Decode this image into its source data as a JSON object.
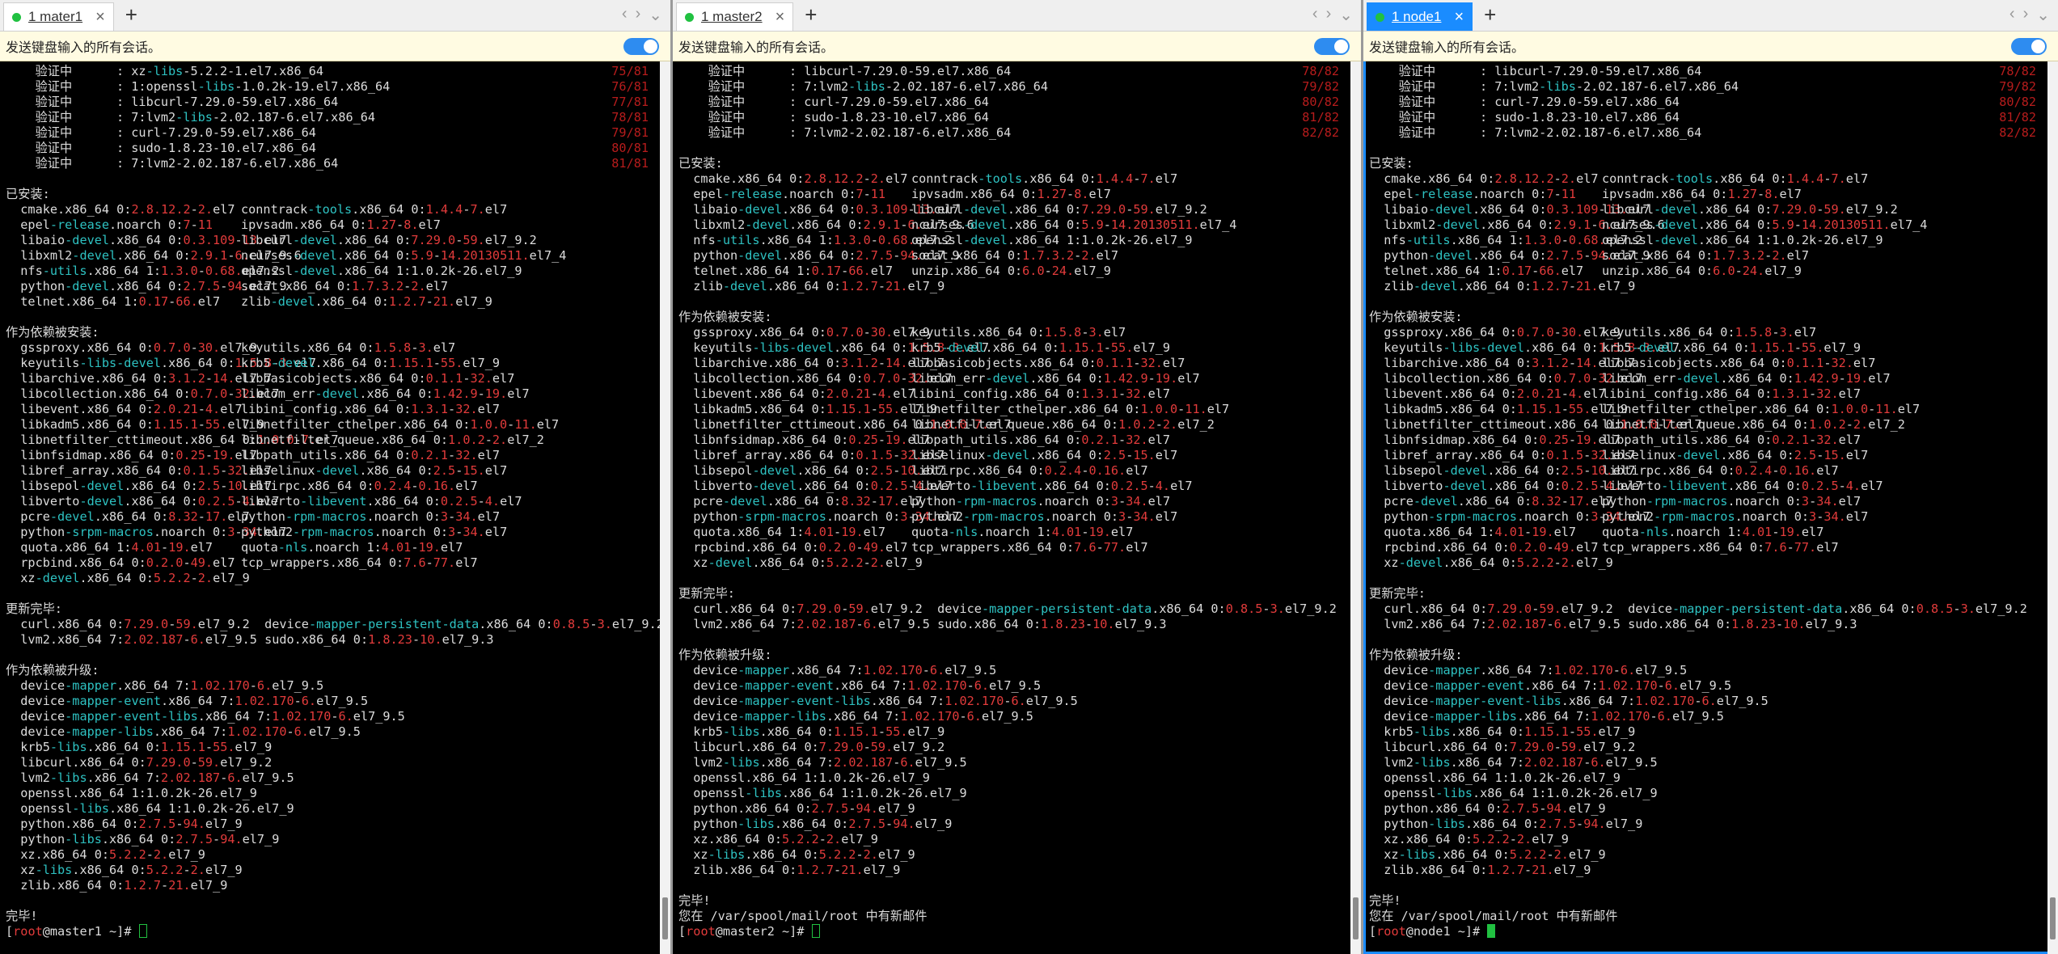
{
  "info_bar": "发送键盘输入的所有会话。",
  "panes": [
    {
      "tab": "1 mater1",
      "prompt_user": "root",
      "prompt_host": "@master1 ~]#",
      "lines": [
        "    验证中      : xz-libs-5.2.2-1.el7.x86_64|75/81",
        "    验证中      : 1:openssl-libs-1.0.2k-19.el7.x86_64|76/81",
        "    验证中      : libcurl-7.29.0-59.el7.x86_64|77/81",
        "    验证中      : 7:lvm2-libs-2.02.187-6.el7.x86_64|78/81",
        "    验证中      : curl-7.29.0-59.el7.x86_64|79/81",
        "    验证中      : sudo-1.8.23-10.el7.x86_64|80/81",
        "    验证中      : 7:lvm2-2.02.187-6.el7.x86_64|81/81",
        "",
        "已安装:",
        "  cmake.x86_64 0:2.8.12.2-2.el7#conntrack-tools.x86_64 0:1.4.4-7.el7",
        "  epel-release.noarch 0:7-11#ipvsadm.x86_64 0:1.27-8.el7",
        "  libaio-devel.x86_64 0:0.3.109-13.el7#libcurl-devel.x86_64 0:7.29.0-59.el7_9.2",
        "  libxml2-devel.x86_64 0:2.9.1-6.el7_9.6#ncurses-devel.x86_64 0:5.9-14.20130511.el7_4",
        "  nfs-utils.x86_64 1:1.3.0-0.68.el7.2#openssl-devel.x86_64 1:1.0.2k-26.el7_9",
        "  python-devel.x86_64 0:2.7.5-94.el7_9#socat.x86_64 0:1.7.3.2-2.el7",
        "  telnet.x86_64 1:0.17-66.el7#zlib-devel.x86_64 0:1.2.7-21.el7_9",
        "",
        "作为依赖被安装:",
        "  gssproxy.x86_64 0:0.7.0-30.el7_9#keyutils.x86_64 0:1.5.8-3.el7",
        "  keyutils-libs-devel.x86_64 0:1.5.8-3.el7#krb5-devel.x86_64 0:1.15.1-55.el7_9",
        "  libarchive.x86_64 0:3.1.2-14.el7_7#libbasicobjects.x86_64 0:0.1.1-32.el7",
        "  libcollection.x86_64 0:0.7.0-32.el7#libcom_err-devel.x86_64 0:1.42.9-19.el7",
        "  libevent.x86_64 0:2.0.21-4.el7#libini_config.x86_64 0:1.3.1-32.el7",
        "  libkadm5.x86_64 0:1.15.1-55.el7_9#libnetfilter_cthelper.x86_64 0:1.0.0-11.el7",
        "  libnetfilter_cttimeout.x86_64 0:1.0.0-7.el7#libnetfilter_queue.x86_64 0:1.0.2-2.el7_2",
        "  libnfsidmap.x86_64 0:0.25-19.el7#libpath_utils.x86_64 0:0.2.1-32.el7",
        "  libref_array.x86_64 0:0.1.5-32.el7#libselinux-devel.x86_64 0:2.5-15.el7",
        "  libsepol-devel.x86_64 0:2.5-10.el7#libtirpc.x86_64 0:0.2.4-0.16.el7",
        "  libverto-devel.x86_64 0:0.2.5-4.el7#libverto-libevent.x86_64 0:0.2.5-4.el7",
        "  pcre-devel.x86_64 0:8.32-17.el7#python-rpm-macros.noarch 0:3-34.el7",
        "  python-srpm-macros.noarch 0:3-34.el7#python2-rpm-macros.noarch 0:3-34.el7",
        "  quota.x86_64 1:4.01-19.el7#quota-nls.noarch 1:4.01-19.el7",
        "  rpcbind.x86_64 0:0.2.0-49.el7#tcp_wrappers.x86_64 0:7.6-77.el7",
        "  xz-devel.x86_64 0:5.2.2-2.el7_9",
        "",
        "更新完毕:",
        "  curl.x86_64 0:7.29.0-59.el7_9.2  device-mapper-persistent-data.x86_64 0:0.8.5-3.el7_9.2",
        "  lvm2.x86_64 7:2.02.187-6.el7_9.5 sudo.x86_64 0:1.8.23-10.el7_9.3",
        "",
        "作为依赖被升级:",
        "  device-mapper.x86_64 7:1.02.170-6.el7_9.5",
        "  device-mapper-event.x86_64 7:1.02.170-6.el7_9.5",
        "  device-mapper-event-libs.x86_64 7:1.02.170-6.el7_9.5",
        "  device-mapper-libs.x86_64 7:1.02.170-6.el7_9.5",
        "  krb5-libs.x86_64 0:1.15.1-55.el7_9",
        "  libcurl.x86_64 0:7.29.0-59.el7_9.2",
        "  lvm2-libs.x86_64 7:2.02.187-6.el7_9.5",
        "  openssl.x86_64 1:1.0.2k-26.el7_9",
        "  openssl-libs.x86_64 1:1.0.2k-26.el7_9",
        "  python.x86_64 0:2.7.5-94.el7_9",
        "  python-libs.x86_64 0:2.7.5-94.el7_9",
        "  xz.x86_64 0:5.2.2-2.el7_9",
        "  xz-libs.x86_64 0:5.2.2-2.el7_9",
        "  zlib.x86_64 0:1.2.7-21.el7_9",
        "",
        "完毕!"
      ]
    },
    {
      "tab": "1 master2",
      "prompt_user": "root",
      "prompt_host": "@master2 ~]#",
      "lines": [
        "    验证中      : libcurl-7.29.0-59.el7.x86_64|78/82",
        "    验证中      : 7:lvm2-libs-2.02.187-6.el7.x86_64|79/82",
        "    验证中      : curl-7.29.0-59.el7.x86_64|80/82",
        "    验证中      : sudo-1.8.23-10.el7.x86_64|81/82",
        "    验证中      : 7:lvm2-2.02.187-6.el7.x86_64|82/82",
        "",
        "已安装:",
        "  cmake.x86_64 0:2.8.12.2-2.el7#conntrack-tools.x86_64 0:1.4.4-7.el7",
        "  epel-release.noarch 0:7-11#ipvsadm.x86_64 0:1.27-8.el7",
        "  libaio-devel.x86_64 0:0.3.109-13.el7#libcurl-devel.x86_64 0:7.29.0-59.el7_9.2",
        "  libxml2-devel.x86_64 0:2.9.1-6.el7_9.6#ncurses-devel.x86_64 0:5.9-14.20130511.el7_4",
        "  nfs-utils.x86_64 1:1.3.0-0.68.el7.2#openssl-devel.x86_64 1:1.0.2k-26.el7_9",
        "  python-devel.x86_64 0:2.7.5-94.el7_9#socat.x86_64 0:1.7.3.2-2.el7",
        "  telnet.x86_64 1:0.17-66.el7#unzip.x86_64 0:6.0-24.el7_9",
        "  zlib-devel.x86_64 0:1.2.7-21.el7_9",
        "",
        "作为依赖被安装:",
        "  gssproxy.x86_64 0:0.7.0-30.el7_9#keyutils.x86_64 0:1.5.8-3.el7",
        "  keyutils-libs-devel.x86_64 0:1.5.8-3.el7#krb5-devel.x86_64 0:1.15.1-55.el7_9",
        "  libarchive.x86_64 0:3.1.2-14.el7_7#libbasicobjects.x86_64 0:0.1.1-32.el7",
        "  libcollection.x86_64 0:0.7.0-32.el7#libcom_err-devel.x86_64 0:1.42.9-19.el7",
        "  libevent.x86_64 0:2.0.21-4.el7#libini_config.x86_64 0:1.3.1-32.el7",
        "  libkadm5.x86_64 0:1.15.1-55.el7_9#libnetfilter_cthelper.x86_64 0:1.0.0-11.el7",
        "  libnetfilter_cttimeout.x86_64 0:1.0.0-7.el7#libnetfilter_queue.x86_64 0:1.0.2-2.el7_2",
        "  libnfsidmap.x86_64 0:0.25-19.el7#libpath_utils.x86_64 0:0.2.1-32.el7",
        "  libref_array.x86_64 0:0.1.5-32.el7#libselinux-devel.x86_64 0:2.5-15.el7",
        "  libsepol-devel.x86_64 0:2.5-10.el7#libtirpc.x86_64 0:0.2.4-0.16.el7",
        "  libverto-devel.x86_64 0:0.2.5-4.el7#libverto-libevent.x86_64 0:0.2.5-4.el7",
        "  pcre-devel.x86_64 0:8.32-17.el7#python-rpm-macros.noarch 0:3-34.el7",
        "  python-srpm-macros.noarch 0:3-34.el7#python2-rpm-macros.noarch 0:3-34.el7",
        "  quota.x86_64 1:4.01-19.el7#quota-nls.noarch 1:4.01-19.el7",
        "  rpcbind.x86_64 0:0.2.0-49.el7#tcp_wrappers.x86_64 0:7.6-77.el7",
        "  xz-devel.x86_64 0:5.2.2-2.el7_9",
        "",
        "更新完毕:",
        "  curl.x86_64 0:7.29.0-59.el7_9.2  device-mapper-persistent-data.x86_64 0:0.8.5-3.el7_9.2",
        "  lvm2.x86_64 7:2.02.187-6.el7_9.5 sudo.x86_64 0:1.8.23-10.el7_9.3",
        "",
        "作为依赖被升级:",
        "  device-mapper.x86_64 7:1.02.170-6.el7_9.5",
        "  device-mapper-event.x86_64 7:1.02.170-6.el7_9.5",
        "  device-mapper-event-libs.x86_64 7:1.02.170-6.el7_9.5",
        "  device-mapper-libs.x86_64 7:1.02.170-6.el7_9.5",
        "  krb5-libs.x86_64 0:1.15.1-55.el7_9",
        "  libcurl.x86_64 0:7.29.0-59.el7_9.2",
        "  lvm2-libs.x86_64 7:2.02.187-6.el7_9.5",
        "  openssl.x86_64 1:1.0.2k-26.el7_9",
        "  openssl-libs.x86_64 1:1.0.2k-26.el7_9",
        "  python.x86_64 0:2.7.5-94.el7_9",
        "  python-libs.x86_64 0:2.7.5-94.el7_9",
        "  xz.x86_64 0:5.2.2-2.el7_9",
        "  xz-libs.x86_64 0:5.2.2-2.el7_9",
        "  zlib.x86_64 0:1.2.7-21.el7_9",
        "",
        "完毕!",
        "您在 /var/spool/mail/root 中有新邮件"
      ]
    },
    {
      "tab": "1 node1",
      "prompt_user": "root",
      "prompt_host": "@node1 ~]#",
      "lines": [
        "    验证中      : libcurl-7.29.0-59.el7.x86_64|78/82",
        "    验证中      : 7:lvm2-libs-2.02.187-6.el7.x86_64|79/82",
        "    验证中      : curl-7.29.0-59.el7.x86_64|80/82",
        "    验证中      : sudo-1.8.23-10.el7.x86_64|81/82",
        "    验证中      : 7:lvm2-2.02.187-6.el7.x86_64|82/82",
        "",
        "已安装:",
        "  cmake.x86_64 0:2.8.12.2-2.el7#conntrack-tools.x86_64 0:1.4.4-7.el7",
        "  epel-release.noarch 0:7-11#ipvsadm.x86_64 0:1.27-8.el7",
        "  libaio-devel.x86_64 0:0.3.109-13.el7#libcurl-devel.x86_64 0:7.29.0-59.el7_9.2",
        "  libxml2-devel.x86_64 0:2.9.1-6.el7_9.6#ncurses-devel.x86_64 0:5.9-14.20130511.el7_4",
        "  nfs-utils.x86_64 1:1.3.0-0.68.el7.2#openssl-devel.x86_64 1:1.0.2k-26.el7_9",
        "  python-devel.x86_64 0:2.7.5-94.el7_9#socat.x86_64 0:1.7.3.2-2.el7",
        "  telnet.x86_64 1:0.17-66.el7#unzip.x86_64 0:6.0-24.el7_9",
        "  zlib-devel.x86_64 0:1.2.7-21.el7_9",
        "",
        "作为依赖被安装:",
        "  gssproxy.x86_64 0:0.7.0-30.el7_9#keyutils.x86_64 0:1.5.8-3.el7",
        "  keyutils-libs-devel.x86_64 0:1.5.8-3.el7#krb5-devel.x86_64 0:1.15.1-55.el7_9",
        "  libarchive.x86_64 0:3.1.2-14.el7_7#libbasicobjects.x86_64 0:0.1.1-32.el7",
        "  libcollection.x86_64 0:0.7.0-32.el7#libcom_err-devel.x86_64 0:1.42.9-19.el7",
        "  libevent.x86_64 0:2.0.21-4.el7#libini_config.x86_64 0:1.3.1-32.el7",
        "  libkadm5.x86_64 0:1.15.1-55.el7_9#libnetfilter_cthelper.x86_64 0:1.0.0-11.el7",
        "  libnetfilter_cttimeout.x86_64 0:1.0.0-7.el7#libnetfilter_queue.x86_64 0:1.0.2-2.el7_2",
        "  libnfsidmap.x86_64 0:0.25-19.el7#libpath_utils.x86_64 0:0.2.1-32.el7",
        "  libref_array.x86_64 0:0.1.5-32.el7#libselinux-devel.x86_64 0:2.5-15.el7",
        "  libsepol-devel.x86_64 0:2.5-10.el7#libtirpc.x86_64 0:0.2.4-0.16.el7",
        "  libverto-devel.x86_64 0:0.2.5-4.el7#libverto-libevent.x86_64 0:0.2.5-4.el7",
        "  pcre-devel.x86_64 0:8.32-17.el7#python-rpm-macros.noarch 0:3-34.el7",
        "  python-srpm-macros.noarch 0:3-34.el7#python2-rpm-macros.noarch 0:3-34.el7",
        "  quota.x86_64 1:4.01-19.el7#quota-nls.noarch 1:4.01-19.el7",
        "  rpcbind.x86_64 0:0.2.0-49.el7#tcp_wrappers.x86_64 0:7.6-77.el7",
        "  xz-devel.x86_64 0:5.2.2-2.el7_9",
        "",
        "更新完毕:",
        "  curl.x86_64 0:7.29.0-59.el7_9.2  device-mapper-persistent-data.x86_64 0:0.8.5-3.el7_9.2",
        "  lvm2.x86_64 7:2.02.187-6.el7_9.5 sudo.x86_64 0:1.8.23-10.el7_9.3",
        "",
        "作为依赖被升级:",
        "  device-mapper.x86_64 7:1.02.170-6.el7_9.5",
        "  device-mapper-event.x86_64 7:1.02.170-6.el7_9.5",
        "  device-mapper-event-libs.x86_64 7:1.02.170-6.el7_9.5",
        "  device-mapper-libs.x86_64 7:1.02.170-6.el7_9.5",
        "  krb5-libs.x86_64 0:1.15.1-55.el7_9",
        "  libcurl.x86_64 0:7.29.0-59.el7_9.2",
        "  lvm2-libs.x86_64 7:2.02.187-6.el7_9.5",
        "  openssl.x86_64 1:1.0.2k-26.el7_9",
        "  openssl-libs.x86_64 1:1.0.2k-26.el7_9",
        "  python.x86_64 0:2.7.5-94.el7_9",
        "  python-libs.x86_64 0:2.7.5-94.el7_9",
        "  xz.x86_64 0:5.2.2-2.el7_9",
        "  xz-libs.x86_64 0:5.2.2-2.el7_9",
        "  zlib.x86_64 0:1.2.7-21.el7_9",
        "",
        "完毕!",
        "您在 /var/spool/mail/root 中有新邮件"
      ]
    }
  ]
}
